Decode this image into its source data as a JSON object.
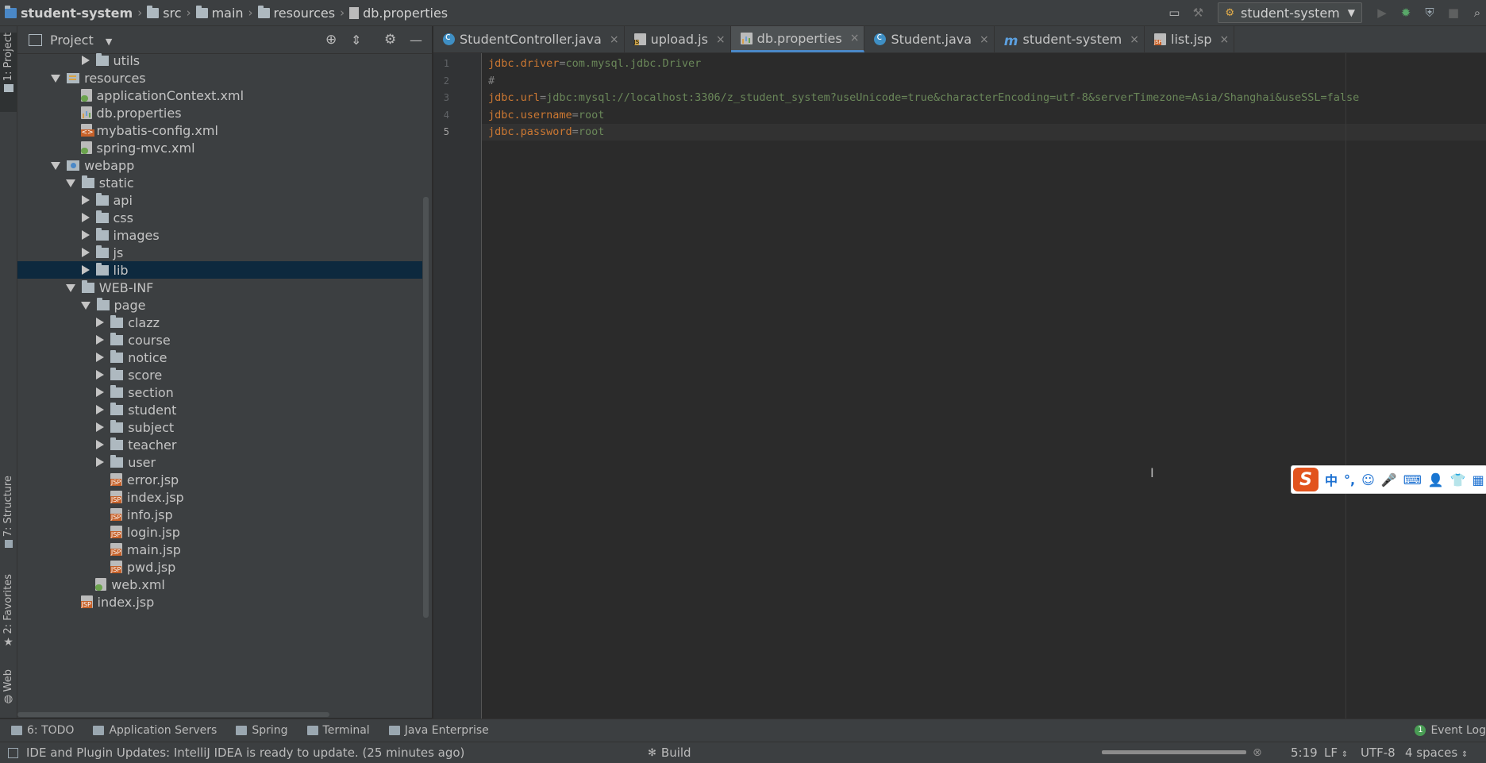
{
  "breadcrumb": [
    "student-system",
    "src",
    "main",
    "resources",
    "db.properties"
  ],
  "run_config": "student-system",
  "left_tabs": {
    "project": "1: Project",
    "structure": "7: Structure",
    "favorites": "2: Favorites",
    "web": "Web"
  },
  "project_panel": {
    "title": "Project"
  },
  "tree": [
    {
      "label": "utils",
      "depth": 5,
      "arrow": "right",
      "icon": "dir"
    },
    {
      "label": "resources",
      "depth": 3,
      "arrow": "down",
      "icon": "res"
    },
    {
      "label": "applicationContext.xml",
      "depth": 5,
      "arrow": "none",
      "icon": "xmlg"
    },
    {
      "label": "db.properties",
      "depth": 5,
      "arrow": "none",
      "icon": "prop"
    },
    {
      "label": "mybatis-config.xml",
      "depth": 5,
      "arrow": "none",
      "icon": "xml"
    },
    {
      "label": "spring-mvc.xml",
      "depth": 5,
      "arrow": "none",
      "icon": "xmlg"
    },
    {
      "label": "webapp",
      "depth": 3,
      "arrow": "down",
      "icon": "web"
    },
    {
      "label": "static",
      "depth": 4,
      "arrow": "down",
      "icon": "dir"
    },
    {
      "label": "api",
      "depth": 5,
      "arrow": "right",
      "icon": "dir"
    },
    {
      "label": "css",
      "depth": 5,
      "arrow": "right",
      "icon": "dir"
    },
    {
      "label": "images",
      "depth": 5,
      "arrow": "right",
      "icon": "dir"
    },
    {
      "label": "js",
      "depth": 5,
      "arrow": "right",
      "icon": "dir"
    },
    {
      "label": "lib",
      "depth": 5,
      "arrow": "right",
      "icon": "dir",
      "selected": true
    },
    {
      "label": "WEB-INF",
      "depth": 4,
      "arrow": "down",
      "icon": "dir"
    },
    {
      "label": "page",
      "depth": 5,
      "arrow": "down",
      "icon": "dir"
    },
    {
      "label": "clazz",
      "depth": 6,
      "arrow": "right",
      "icon": "dir"
    },
    {
      "label": "course",
      "depth": 6,
      "arrow": "right",
      "icon": "dir"
    },
    {
      "label": "notice",
      "depth": 6,
      "arrow": "right",
      "icon": "dir"
    },
    {
      "label": "score",
      "depth": 6,
      "arrow": "right",
      "icon": "dir"
    },
    {
      "label": "section",
      "depth": 6,
      "arrow": "right",
      "icon": "dir"
    },
    {
      "label": "student",
      "depth": 6,
      "arrow": "right",
      "icon": "dir"
    },
    {
      "label": "subject",
      "depth": 6,
      "arrow": "right",
      "icon": "dir"
    },
    {
      "label": "teacher",
      "depth": 6,
      "arrow": "right",
      "icon": "dir"
    },
    {
      "label": "user",
      "depth": 6,
      "arrow": "right",
      "icon": "dir"
    },
    {
      "label": "error.jsp",
      "depth": 7,
      "arrow": "none",
      "icon": "jsp"
    },
    {
      "label": "index.jsp",
      "depth": 7,
      "arrow": "none",
      "icon": "jsp"
    },
    {
      "label": "info.jsp",
      "depth": 7,
      "arrow": "none",
      "icon": "jsp"
    },
    {
      "label": "login.jsp",
      "depth": 7,
      "arrow": "none",
      "icon": "jsp"
    },
    {
      "label": "main.jsp",
      "depth": 7,
      "arrow": "none",
      "icon": "jsp"
    },
    {
      "label": "pwd.jsp",
      "depth": 7,
      "arrow": "none",
      "icon": "jsp"
    },
    {
      "label": "web.xml",
      "depth": 6,
      "arrow": "none",
      "icon": "xmlg"
    },
    {
      "label": "index.jsp",
      "depth": 5,
      "arrow": "none",
      "icon": "jsp"
    }
  ],
  "tabs": [
    {
      "label": "StudentController.java",
      "icon": "cls",
      "active": false
    },
    {
      "label": "upload.js",
      "icon": "js",
      "active": false
    },
    {
      "label": "db.properties",
      "icon": "prop",
      "active": true
    },
    {
      "label": "Student.java",
      "icon": "cls",
      "active": false
    },
    {
      "label": "student-system",
      "icon": "mvn",
      "active": false
    },
    {
      "label": "list.jsp",
      "icon": "jsp",
      "active": false
    }
  ],
  "code_lines": [
    {
      "num": "1",
      "key": "jdbc.driver",
      "eq": "=",
      "val": "com.mysql.jdbc.Driver"
    },
    {
      "num": "2",
      "comment": "#"
    },
    {
      "num": "3",
      "key": "jdbc.url",
      "eq": "=",
      "val": "jdbc:mysql://localhost:3306/z_student_system?useUnicode=true&characterEncoding=utf-8&serverTimezone=Asia/Shanghai&useSSL=false"
    },
    {
      "num": "4",
      "key": "jdbc.username",
      "eq": "=",
      "val": "root"
    },
    {
      "num": "5",
      "key": "jdbc.password",
      "eq": "=",
      "val": "root",
      "current": true
    }
  ],
  "ime": {
    "logo": "S",
    "items": [
      "中",
      "°,",
      "☺",
      "🎤",
      "⌨",
      "👤",
      "👕",
      "▦"
    ]
  },
  "bottom_tools": [
    "6: TODO",
    "Application Servers",
    "Spring",
    "Terminal",
    "Java Enterprise"
  ],
  "event_log": {
    "badge": "1",
    "label": "Event Log"
  },
  "status": {
    "message": "IDE and Plugin Updates: IntelliJ IDEA is ready to update. (25 minutes ago)",
    "build": "Build",
    "position": "5:19",
    "line_sep": "LF",
    "encoding": "UTF-8",
    "indent": "4 spaces"
  }
}
